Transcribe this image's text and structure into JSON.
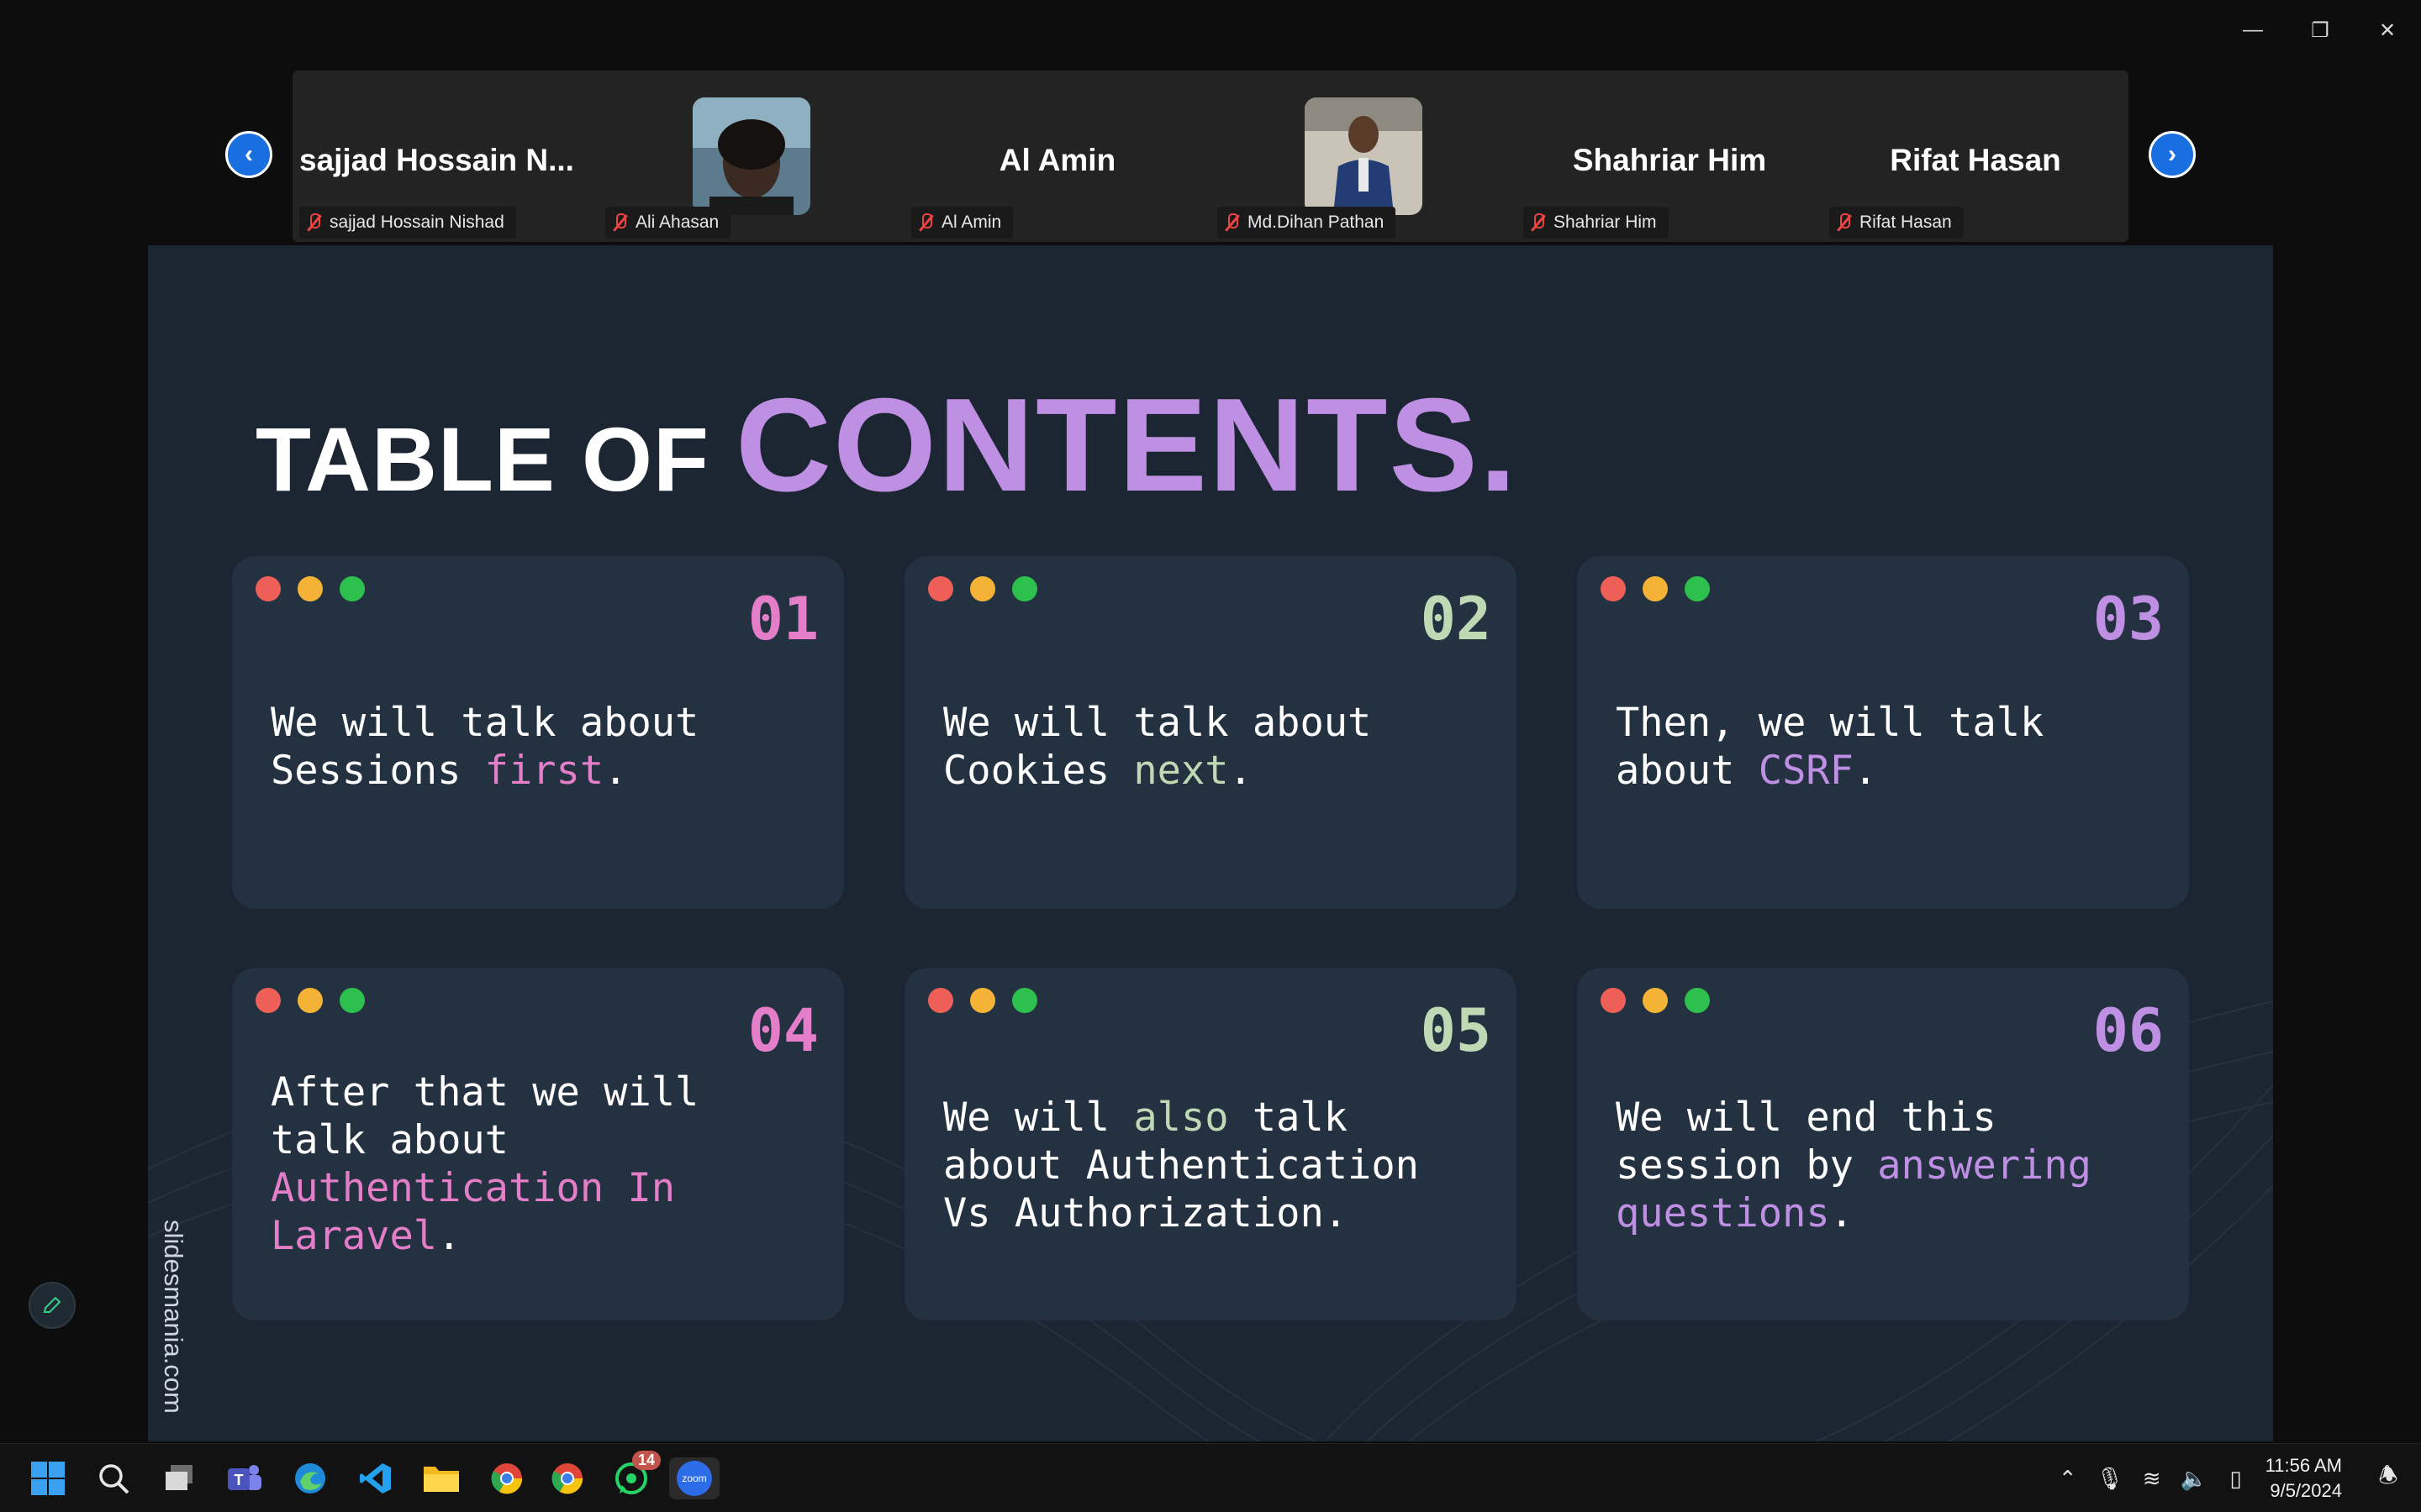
{
  "participants": [
    {
      "display": "sajjad  Hossain  N...",
      "name": "sajjad Hossain Nishad"
    },
    {
      "display": "",
      "name": "Ali Ahasan"
    },
    {
      "display": "Al Amin",
      "name": "Al Amin"
    },
    {
      "display": "",
      "name": "Md.Dihan Pathan"
    },
    {
      "display": "Shahriar Him",
      "name": "Shahriar Him"
    },
    {
      "display": "Rifat Hasan",
      "name": "Rifat Hasan"
    }
  ],
  "slide": {
    "title_plain": "TABLE OF ",
    "title_accent": "CONTENTS.",
    "credit": "slidesmania.com",
    "cards": [
      {
        "num": "01",
        "num_color": "#e57ec8",
        "before": "We will talk about Sessions ",
        "highlight": "first",
        "after": ".",
        "highlight_color": "#e57ec8"
      },
      {
        "num": "02",
        "num_color": "#bfd9b4",
        "before": "We will talk about Cookies ",
        "highlight": "next",
        "after": ".",
        "highlight_color": "#bfd9b4"
      },
      {
        "num": "03",
        "num_color": "#be8fe3",
        "before": "Then, we will talk about ",
        "highlight": "CSRF",
        "after": ".",
        "highlight_color": "#be8fe3"
      },
      {
        "num": "04",
        "num_color": "#e57ec8",
        "before": "After that we will talk about ",
        "highlight": "Authentication In Laravel",
        "after": ".",
        "highlight_color": "#e57ec8"
      },
      {
        "num": "05",
        "num_color": "#bfd9b4",
        "before": "We will ",
        "highlight": "also",
        "after": " talk about Authentication Vs Authorization.",
        "highlight_color": "#bfd9b4"
      },
      {
        "num": "06",
        "num_color": "#be8fe3",
        "before": "We will end this session by ",
        "highlight": "answering questions",
        "after": ".",
        "highlight_color": "#be8fe3"
      }
    ]
  },
  "taskbar": {
    "whatsapp_badge": "14",
    "zoom_label": "zoom",
    "time": "11:56 AM",
    "date": "9/5/2024"
  },
  "colors": {
    "dot_red": "#ee5f57",
    "dot_yellow": "#f4b336",
    "dot_green": "#2ec04c",
    "nav_blue": "#1a6fe0"
  }
}
